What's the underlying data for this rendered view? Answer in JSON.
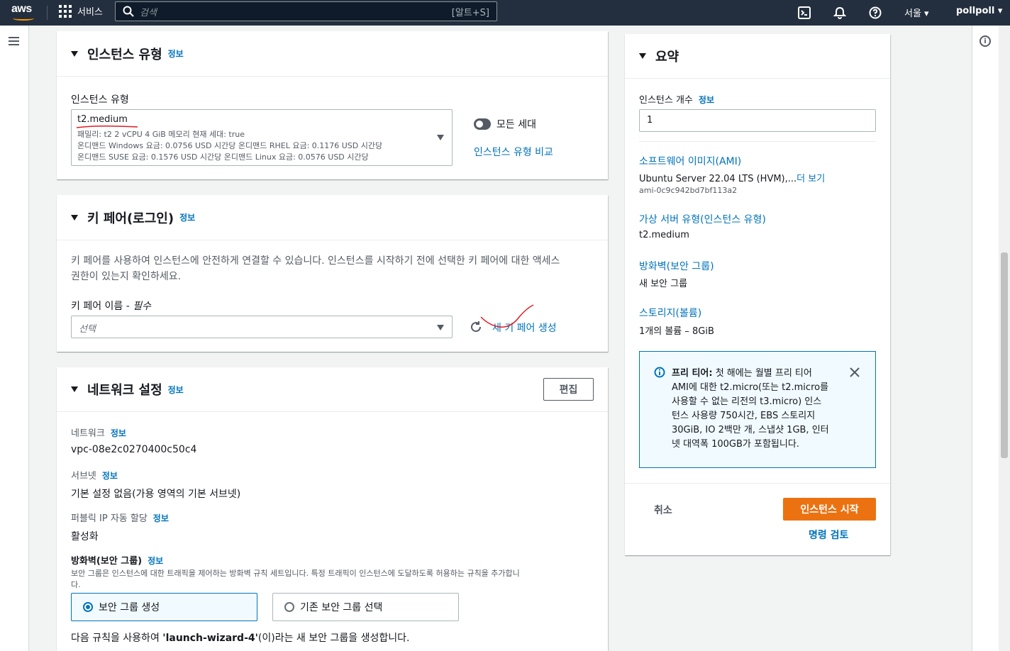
{
  "topnav": {
    "logo": "aws",
    "services_label": "서비스",
    "search_placeholder": "검색",
    "search_shortcut": "[알트+S]",
    "region": "서울 ▾",
    "user": "pollpoll ▾",
    "icons": [
      "cloudshell-icon",
      "bell-icon",
      "help-icon"
    ]
  },
  "instance_type": {
    "title": "인스턴스 유형",
    "info": "정보",
    "field_label": "인스턴스 유형",
    "selected": "t2.medium",
    "detail_line1": "패밀리: t2    2 vCPU    4 GiB 메모리    현재 세대: true",
    "detail_line2": "온디맨드 Windows 요금: 0.0756 USD 시간당    온디맨드 RHEL 요금: 0.1176 USD 시간당",
    "detail_line3": "온디맨드 SUSE 요금: 0.1576 USD 시간당    온디맨드 Linux 요금: 0.0576 USD 시간당",
    "toggle_label": "모든 세대",
    "compare_link": "인스턴스 유형 비교"
  },
  "key_pair": {
    "title": "키 페어(로그인)",
    "info": "정보",
    "description_line1": "키 페어를 사용하여 인스턴스에 안전하게 연결할 수 있습니다. 인스턴스를 시작하기 전에 선택한 키 페어에 대한 액세스",
    "description_line2": "권한이 있는지 확인하세요.",
    "field_label": "키 페어 이름 - ",
    "required": "필수",
    "select_placeholder": "선택",
    "create_link": "새 키 페어 생성"
  },
  "network": {
    "title": "네트워크 설정",
    "info": "정보",
    "edit_button": "편집",
    "network_label": "네트워크",
    "network_value": "vpc-08e2c0270400c50c4",
    "subnet_label": "서브넷",
    "subnet_value": "기본 설정 없음(가용 영역의 기본 서브넷)",
    "public_ip_label": "퍼블릭 IP 자동 할당",
    "public_ip_value": "활성화",
    "firewall_label": "방화벽(보안 그룹)",
    "firewall_desc_line1": "보안 그룹은 인스턴스에 대한 트래픽을 제어하는 방화벽 규칙 세트입니다. 특정 트래픽이 인스턴스에 도달하도록 허용하는 규칙을 추가합니",
    "firewall_desc_line2": "다.",
    "radio_create": "보안 그룹 생성",
    "radio_existing": "기존 보안 그룹 선택",
    "rule_prefix": "다음 규칙을 사용하여 ",
    "rule_name": "'launch-wizard-4'",
    "rule_suffix": "(이)라는 새 보안 그룹을 생성합니다."
  },
  "summary": {
    "title": "요약",
    "count_label": "인스턴스 개수",
    "info": "정보",
    "count_value": "1",
    "ami_link": "소프트웨어 이미지(AMI)",
    "ami_value": "Ubuntu Server 22.04 LTS (HVM),...",
    "ami_more": "더 보기",
    "ami_id": "ami-0c9c942bd7bf113a2",
    "vserver_link": "가상 서버 유형(인스턴스 유형)",
    "vserver_value": "t2.medium",
    "firewall_link": "방화벽(보안 그룹)",
    "firewall_value": "새 보안 그룹",
    "storage_link": "스토리지(볼륨)",
    "storage_value": "1개의 볼륨 – 8GiB",
    "free_tier_bold": "프리 티어:",
    "free_tier_line1": " 첫 해에는 월별 프리 티어",
    "free_tier_line2": "AMI에 대한 t2.micro(또는 t2.micro를",
    "free_tier_line3": "사용할 수 없는 리전의 t3.micro) 인스",
    "free_tier_line4": "턴스 사용량 750시간, EBS 스토리지",
    "free_tier_line5": "30GiB, IO 2백만 개, 스냅샷 1GB, 인터",
    "free_tier_line6": "넷 대역폭 100GB가 포함됩니다.",
    "cancel": "취소",
    "launch": "인스턴스 시작",
    "review": "명령 검토"
  },
  "colors": {
    "nav_bg": "#232f3e",
    "link": "#0073bb",
    "primary_button": "#ec7211",
    "annotation": "#e01b24"
  }
}
